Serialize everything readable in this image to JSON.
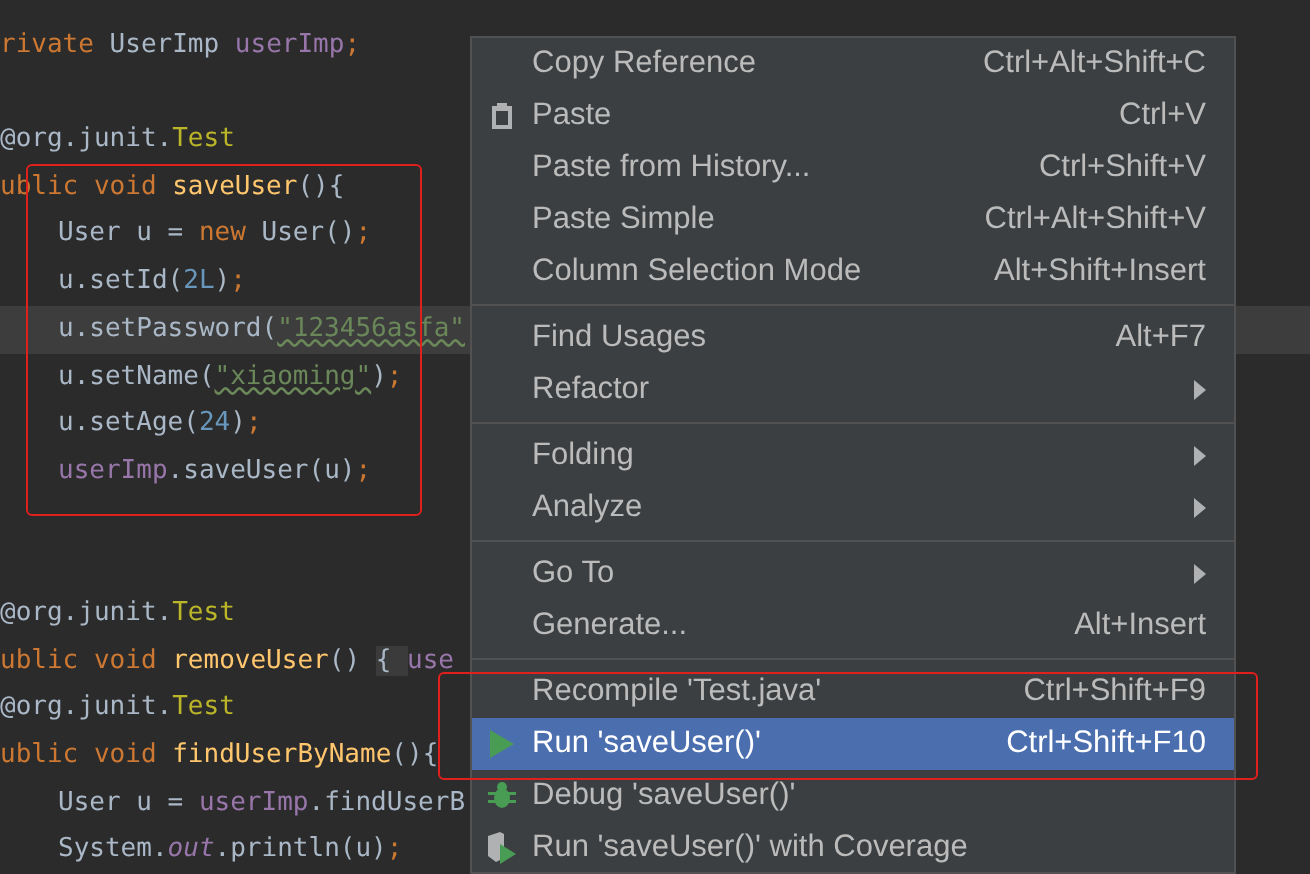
{
  "editor": {
    "lines": [
      {
        "kind": "blank"
      },
      {
        "kind": "code",
        "indented": false,
        "current": false,
        "tokens": [
          {
            "text": "rivate ",
            "kind": "keyword"
          },
          {
            "text": "UserImp ",
            "kind": "plain"
          },
          {
            "text": "userImp",
            "kind": "field"
          },
          {
            "text": ";",
            "kind": "keyword"
          }
        ]
      },
      {
        "kind": "blank"
      },
      {
        "kind": "code",
        "indented": false,
        "current": false,
        "tokens": [
          {
            "text": "@org.junit.",
            "kind": "plain"
          },
          {
            "text": "Test",
            "kind": "annotation"
          }
        ]
      },
      {
        "kind": "code",
        "indented": false,
        "current": false,
        "tokens": [
          {
            "text": "ublic void ",
            "kind": "keyword"
          },
          {
            "text": "saveUser",
            "kind": "method"
          },
          {
            "text": "(){",
            "kind": "plain"
          }
        ]
      },
      {
        "kind": "code",
        "indented": true,
        "current": false,
        "tokens": [
          {
            "text": "User u = ",
            "kind": "plain"
          },
          {
            "text": "new ",
            "kind": "keyword"
          },
          {
            "text": "User()",
            "kind": "plain"
          },
          {
            "text": ";",
            "kind": "keyword"
          }
        ]
      },
      {
        "kind": "code",
        "indented": true,
        "current": false,
        "tokens": [
          {
            "text": "u.setId(",
            "kind": "plain"
          },
          {
            "text": "2L",
            "kind": "number"
          },
          {
            "text": ")",
            "kind": "plain"
          },
          {
            "text": ";",
            "kind": "keyword"
          }
        ]
      },
      {
        "kind": "code",
        "indented": true,
        "current": true,
        "tokens": [
          {
            "text": "u.setPassword(",
            "kind": "plain"
          },
          {
            "text": "\"123456asfa\"",
            "kind": "string",
            "typo": true
          }
        ]
      },
      {
        "kind": "code",
        "indented": true,
        "current": false,
        "tokens": [
          {
            "text": "u.setName(",
            "kind": "plain"
          },
          {
            "text": "\"xiaoming\"",
            "kind": "string",
            "typo": true
          },
          {
            "text": ")",
            "kind": "plain"
          },
          {
            "text": ";",
            "kind": "keyword"
          }
        ]
      },
      {
        "kind": "code",
        "indented": true,
        "current": false,
        "tokens": [
          {
            "text": "u.setAge(",
            "kind": "plain"
          },
          {
            "text": "24",
            "kind": "number"
          },
          {
            "text": ")",
            "kind": "plain"
          },
          {
            "text": ";",
            "kind": "keyword"
          }
        ]
      },
      {
        "kind": "code",
        "indented": true,
        "current": false,
        "tokens": [
          {
            "text": "userImp",
            "kind": "field"
          },
          {
            "text": ".saveUser(u)",
            "kind": "plain"
          },
          {
            "text": ";",
            "kind": "keyword"
          }
        ]
      },
      {
        "kind": "blank"
      },
      {
        "kind": "blank"
      },
      {
        "kind": "code",
        "indented": false,
        "current": false,
        "tokens": [
          {
            "text": "@org.junit.",
            "kind": "plain"
          },
          {
            "text": "Test",
            "kind": "annotation"
          }
        ]
      },
      {
        "kind": "code",
        "indented": false,
        "current": false,
        "tokens": [
          {
            "text": "ublic void ",
            "kind": "keyword"
          },
          {
            "text": "removeUser",
            "kind": "method"
          },
          {
            "text": "() ",
            "kind": "plain"
          },
          {
            "text": "{ ",
            "kind": "fold"
          },
          {
            "text": "use",
            "kind": "field"
          }
        ]
      },
      {
        "kind": "code",
        "indented": false,
        "current": false,
        "tokens": [
          {
            "text": "@org.junit.",
            "kind": "plain"
          },
          {
            "text": "Test",
            "kind": "annotation"
          }
        ]
      },
      {
        "kind": "code",
        "indented": false,
        "current": false,
        "tokens": [
          {
            "text": "ublic void ",
            "kind": "keyword"
          },
          {
            "text": "findUserByName",
            "kind": "method"
          },
          {
            "text": "(){",
            "kind": "plain"
          }
        ]
      },
      {
        "kind": "code",
        "indented": true,
        "current": false,
        "tokens": [
          {
            "text": "User u = ",
            "kind": "plain"
          },
          {
            "text": "userImp",
            "kind": "field"
          },
          {
            "text": ".findUserB",
            "kind": "plain"
          }
        ]
      },
      {
        "kind": "code",
        "indented": true,
        "current": false,
        "tokens": [
          {
            "text": "System.",
            "kind": "plain"
          },
          {
            "text": "out",
            "kind": "static"
          },
          {
            "text": ".println(u)",
            "kind": "plain"
          },
          {
            "text": ";",
            "kind": "keyword"
          }
        ]
      }
    ]
  },
  "context_menu": {
    "items": [
      {
        "kind": "item",
        "label": "Copy Reference",
        "shortcut": "Ctrl+Alt+Shift+C",
        "selected": false
      },
      {
        "kind": "paste",
        "label": "Paste",
        "shortcut": "Ctrl+V",
        "selected": false
      },
      {
        "kind": "item",
        "label": "Paste from History...",
        "shortcut": "Ctrl+Shift+V",
        "selected": false
      },
      {
        "kind": "item",
        "label": "Paste Simple",
        "shortcut": "Ctrl+Alt+Shift+V",
        "selected": false
      },
      {
        "kind": "item",
        "label": "Column Selection Mode",
        "shortcut": "Alt+Shift+Insert",
        "selected": false
      },
      {
        "kind": "separator"
      },
      {
        "kind": "item",
        "label": "Find Usages",
        "shortcut": "Alt+F7",
        "selected": false
      },
      {
        "kind": "item",
        "label": "Refactor",
        "submenu": true,
        "selected": false
      },
      {
        "kind": "separator"
      },
      {
        "kind": "item",
        "label": "Folding",
        "submenu": true,
        "selected": false
      },
      {
        "kind": "item",
        "label": "Analyze",
        "submenu": true,
        "selected": false
      },
      {
        "kind": "separator"
      },
      {
        "kind": "item",
        "label": "Go To",
        "submenu": true,
        "selected": false
      },
      {
        "kind": "item",
        "label": "Generate...",
        "shortcut": "Alt+Insert",
        "selected": false
      },
      {
        "kind": "separator"
      },
      {
        "kind": "item",
        "label": "Recompile 'Test.java'",
        "shortcut": "Ctrl+Shift+F9",
        "selected": false
      },
      {
        "kind": "run",
        "label": "Run 'saveUser()'",
        "shortcut": "Ctrl+Shift+F10",
        "selected": true
      },
      {
        "kind": "debug",
        "label": "Debug 'saveUser()'",
        "selected": false
      },
      {
        "kind": "coverage",
        "label": "Run 'saveUser()' with Coverage",
        "selected": false
      }
    ]
  }
}
